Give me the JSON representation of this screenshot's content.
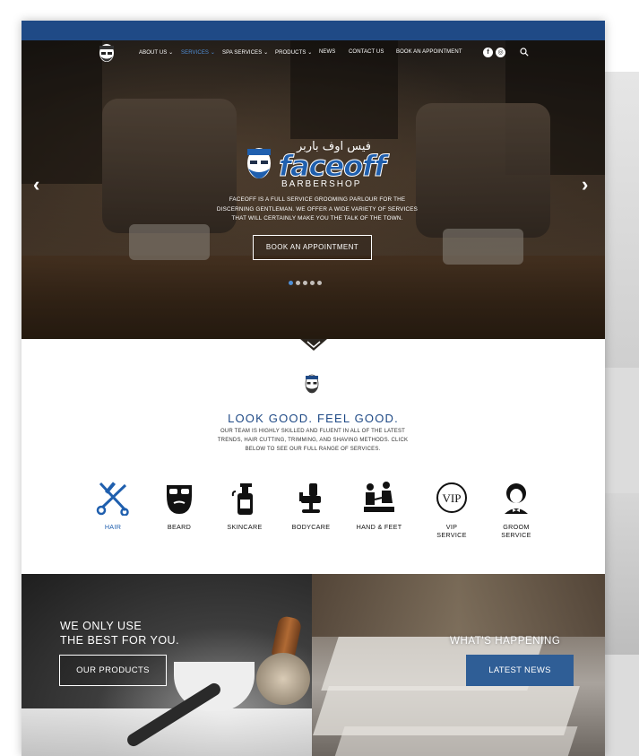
{
  "nav": {
    "items": [
      {
        "label": "ABOUT US",
        "dropdown": true
      },
      {
        "label": "SERVICES",
        "dropdown": true,
        "active": true
      },
      {
        "label": "SPA SERVICES",
        "dropdown": true
      },
      {
        "label": "PRODUCTS",
        "dropdown": true
      },
      {
        "label": "NEWS",
        "dropdown": false
      },
      {
        "label": "CONTACT US",
        "dropdown": false
      },
      {
        "label": "BOOK AN APPOINTMENT",
        "dropdown": false
      }
    ],
    "social": [
      "facebook-icon",
      "instagram-icon"
    ],
    "search_icon": "search-icon"
  },
  "hero": {
    "brand_arabic": "فيس اوف باربر",
    "brand_word": "faceoff",
    "brand_sub": "BARBERSHOP",
    "description": "FACEOFF IS A FULL SERVICE GROOMING PARLOUR FOR THE DISCERNING GENTLEMAN. WE OFFER A WIDE VARIETY OF SERVICES THAT WILL CERTAINLY MAKE YOU THE TALK OF THE TOWN.",
    "cta": "BOOK AN APPOINTMENT",
    "prev_arrow": "‹",
    "next_arrow": "›",
    "slides": 5,
    "active_slide": 1
  },
  "intro": {
    "headline": "LOOK GOOD. FEEL GOOD.",
    "text": "OUR TEAM IS HIGHLY SKILLED AND FLUENT IN ALL OF THE LATEST TRENDS, HAIR CUTTING, TRIMMING, AND SHAVING METHODS. CLICK BELOW TO SEE OUR FULL RANGE OF SERVICES."
  },
  "services": [
    {
      "label": "HAIR",
      "icon": "scissors-comb-icon",
      "active": true
    },
    {
      "label": "BEARD",
      "icon": "beard-icon"
    },
    {
      "label": "SKINCARE",
      "icon": "lotion-bottle-icon"
    },
    {
      "label": "BODYCARE",
      "icon": "barber-chair-icon"
    },
    {
      "label": "HAND & FEET",
      "icon": "pedicure-icon"
    },
    {
      "label": "VIP\nSERVICE",
      "label_line1": "VIP",
      "label_line2": "SERVICE",
      "icon": "vip-badge-icon"
    },
    {
      "label": "GROOM\nSERVICE",
      "label_line1": "GROOM",
      "label_line2": "SERVICE",
      "icon": "groom-icon"
    }
  ],
  "panels": {
    "left": {
      "title_line1": "WE ONLY USE",
      "title_line2": "THE BEST FOR YOU.",
      "button": "OUR PRODUCTS"
    },
    "right": {
      "title": "WHAT'S HAPPENING",
      "button": "LATEST NEWS"
    }
  },
  "colors": {
    "brand_blue": "#1f4a86",
    "accent_blue": "#4f8fd6",
    "button_blue": "#2f5e96"
  }
}
